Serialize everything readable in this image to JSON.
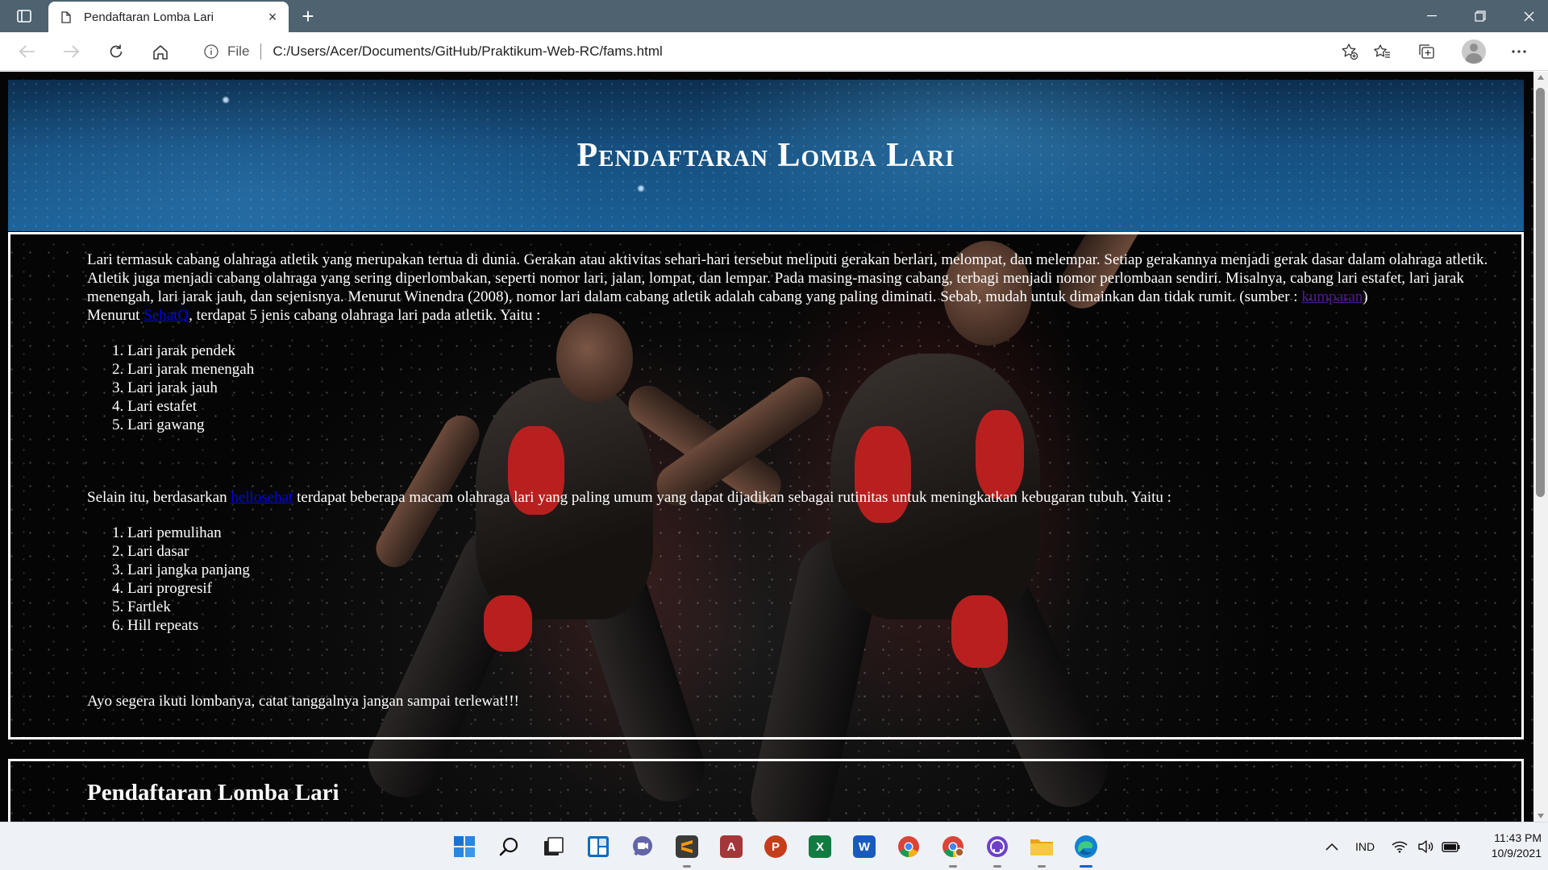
{
  "browser": {
    "tab_title": "Pendaftaran Lomba Lari",
    "address_scheme": "File",
    "address_url": "C:/Users/Acer/Documents/GitHub/Praktikum-Web-RC/fams.html",
    "new_tab_glyph": "+",
    "tab_close_glyph": "×"
  },
  "page": {
    "header_title": "Pendaftaran Lomba Lari",
    "intro_text": "Lari termasuk cabang olahraga atletik yang merupakan tertua di dunia. Gerakan atau aktivitas sehari-hari tersebut meliputi gerakan berlari, melompat, dan melempar. Setiap gerakannya menjadi gerak dasar dalam olahraga atletik. Atletik juga menjadi cabang olahraga yang sering diperlombakan, seperti nomor lari, jalan, lompat, dan lempar. Pada masing-masing cabang, terbagi menjadi nomor perlombaan sendiri. Misalnya, cabang lari estafet, lari jarak menengah, lari jarak jauh, dan sejenisnya. Menurut Winendra (2008), nomor lari dalam cabang atletik adalah cabang yang paling diminati. Sebab, mudah untuk dimainkan dan tidak rumit. (sumber : ",
    "intro_link": "kumparan",
    "intro_close": ")",
    "menurut_prefix": "Menurut ",
    "menurut_link": "SehatQ",
    "menurut_suffix": ", terdapat 5 jenis cabang olahraga lari pada atletik. Yaitu :",
    "list1": [
      "Lari jarak pendek",
      "Lari jarak menengah",
      "Lari jarak jauh",
      "Lari estafet",
      "Lari gawang"
    ],
    "para2_prefix": "Selain itu, berdasarkan ",
    "para2_link": "hellosehat",
    "para2_suffix": " terdapat beberapa macam olahraga lari yang paling umum yang dapat dijadikan sebagai rutinitas untuk meningkatkan kebugaran tubuh. Yaitu :",
    "list2": [
      "Lari pemulihan",
      "Lari dasar",
      "Lari jangka panjang",
      "Lari progresif",
      "Fartlek",
      "Hill repeats"
    ],
    "closing_text": "Ayo segera ikuti lombanya, catat tanggalnya jangan sampai terlewat!!!",
    "form_heading": "Pendaftaran Lomba Lari"
  },
  "taskbar": {
    "apps": [
      "windows-start",
      "search",
      "task-view",
      "widgets",
      "teams-chat",
      "sublime-text",
      "access",
      "powerpoint",
      "excel",
      "word",
      "chrome",
      "chrome-profile",
      "github-desktop",
      "file-explorer",
      "edge"
    ],
    "tray_language": "IND",
    "time": "11:43 PM",
    "date": "10/9/2021"
  },
  "colors": {
    "titlebar": "#4e6270",
    "link": "#0000ee",
    "link_visited": "#551a8b",
    "taskbar": "#eef1f6"
  }
}
